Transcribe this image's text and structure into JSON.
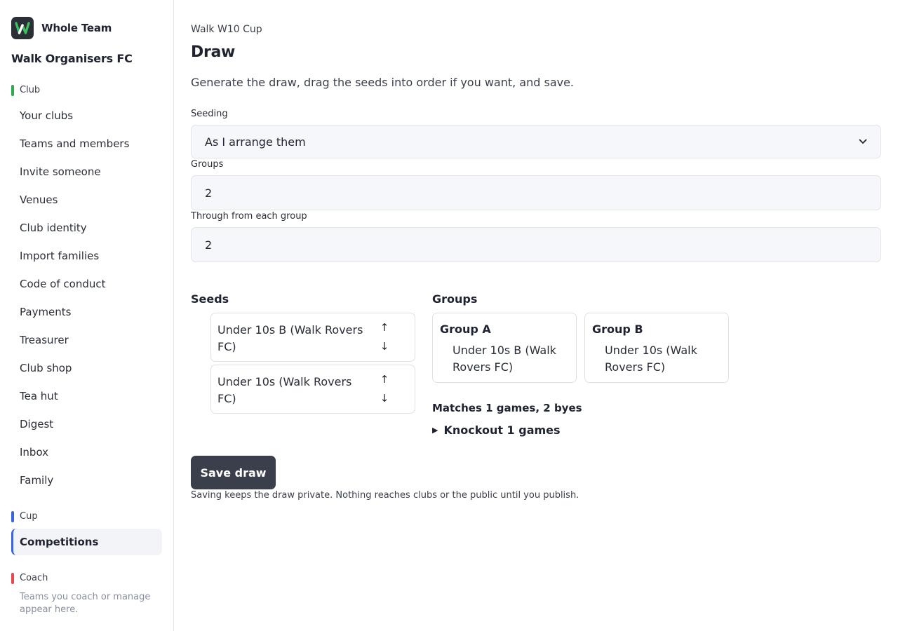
{
  "brand": {
    "name": "Whole Team"
  },
  "org": {
    "name": "Walk Organisers FC"
  },
  "sidebar": {
    "club_label": "Club",
    "club_items": [
      "Your clubs",
      "Teams and members",
      "Invite someone",
      "Venues",
      "Club identity",
      "Import families",
      "Code of conduct",
      "Payments",
      "Treasurer",
      "Club shop",
      "Tea hut",
      "Digest",
      "Inbox",
      "Family"
    ],
    "cup_label": "Cup",
    "cup_active": "Competitions",
    "coach_label": "Coach",
    "coach_note": "Teams you coach or manage appear here."
  },
  "colors": {
    "club": "#2fa84f",
    "cup": "#3e63dd",
    "coach": "#e5484d",
    "button": "#3a3f4b"
  },
  "page": {
    "breadcrumb": "Walk W10 Cup",
    "title": "Draw",
    "lead": "Generate the draw, drag the seeds into order if you want, and save."
  },
  "form": {
    "seeding_label": "Seeding",
    "seeding_value": "As I arrange them",
    "groups_label": "Groups",
    "groups_value": "2",
    "through_label": "Through from each group",
    "through_value": "2"
  },
  "seeds": {
    "title": "Seeds",
    "items": [
      "Under 10s B (Walk Rovers FC)",
      "Under 10s (Walk Rovers FC)"
    ]
  },
  "groups": {
    "title": "Groups",
    "items": [
      {
        "name": "Group A",
        "members": [
          "Under 10s B (Walk Rovers FC)"
        ]
      },
      {
        "name": "Group B",
        "members": [
          "Under 10s (Walk Rovers FC)"
        ]
      }
    ]
  },
  "summary": {
    "matches": "Matches 1 games, 2 byes",
    "knockout": "Knockout 1 games"
  },
  "actions": {
    "save_label": "Save draw",
    "save_note": "Saving keeps the draw private. Nothing reaches clubs or the public until you publish."
  }
}
